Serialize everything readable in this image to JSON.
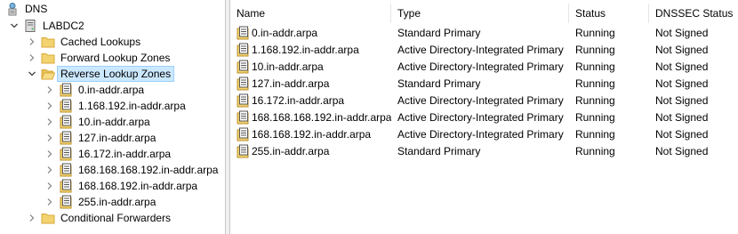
{
  "tree": {
    "root": {
      "label": "DNS",
      "icon": "dns-server-icon"
    },
    "server": {
      "label": "LABDC2",
      "icon": "server-icon",
      "expanded": true
    },
    "folders": [
      {
        "label": "Cached Lookups",
        "icon": "folder-icon",
        "expanded": false
      },
      {
        "label": "Forward Lookup Zones",
        "icon": "folder-icon",
        "expanded": false
      },
      {
        "label": "Reverse Lookup Zones",
        "icon": "folder-icon",
        "expanded": true,
        "selected": true
      },
      {
        "label": "Conditional Forwarders",
        "icon": "folder-icon",
        "expanded": false
      }
    ],
    "reverse_zones": [
      {
        "label": "0.in-addr.arpa"
      },
      {
        "label": "1.168.192.in-addr.arpa"
      },
      {
        "label": "10.in-addr.arpa"
      },
      {
        "label": "127.in-addr.arpa"
      },
      {
        "label": "16.172.in-addr.arpa"
      },
      {
        "label": "168.168.168.192.in-addr.arpa"
      },
      {
        "label": "168.168.192.in-addr.arpa"
      },
      {
        "label": "255.in-addr.arpa"
      }
    ]
  },
  "list": {
    "columns": {
      "name": "Name",
      "type": "Type",
      "status": "Status",
      "dnssec": "DNSSEC Status"
    },
    "rows": [
      {
        "name": "0.in-addr.arpa",
        "type": "Standard Primary",
        "status": "Running",
        "dnssec": "Not Signed"
      },
      {
        "name": "1.168.192.in-addr.arpa",
        "type": "Active Directory-Integrated Primary",
        "status": "Running",
        "dnssec": "Not Signed"
      },
      {
        "name": "10.in-addr.arpa",
        "type": "Active Directory-Integrated Primary",
        "status": "Running",
        "dnssec": "Not Signed"
      },
      {
        "name": "127.in-addr.arpa",
        "type": "Standard Primary",
        "status": "Running",
        "dnssec": "Not Signed"
      },
      {
        "name": "16.172.in-addr.arpa",
        "type": "Active Directory-Integrated Primary",
        "status": "Running",
        "dnssec": "Not Signed"
      },
      {
        "name": "168.168.168.192.in-addr.arpa",
        "type": "Active Directory-Integrated Primary",
        "status": "Running",
        "dnssec": "Not Signed"
      },
      {
        "name": "168.168.192.in-addr.arpa",
        "type": "Active Directory-Integrated Primary",
        "status": "Running",
        "dnssec": "Not Signed"
      },
      {
        "name": "255.in-addr.arpa",
        "type": "Standard Primary",
        "status": "Running",
        "dnssec": "Not Signed"
      }
    ]
  },
  "colors": {
    "selection": "#cce8ff",
    "selection_border": "#99d1ff",
    "folder": "#f3d36f",
    "folder_edge": "#d9a93a"
  }
}
